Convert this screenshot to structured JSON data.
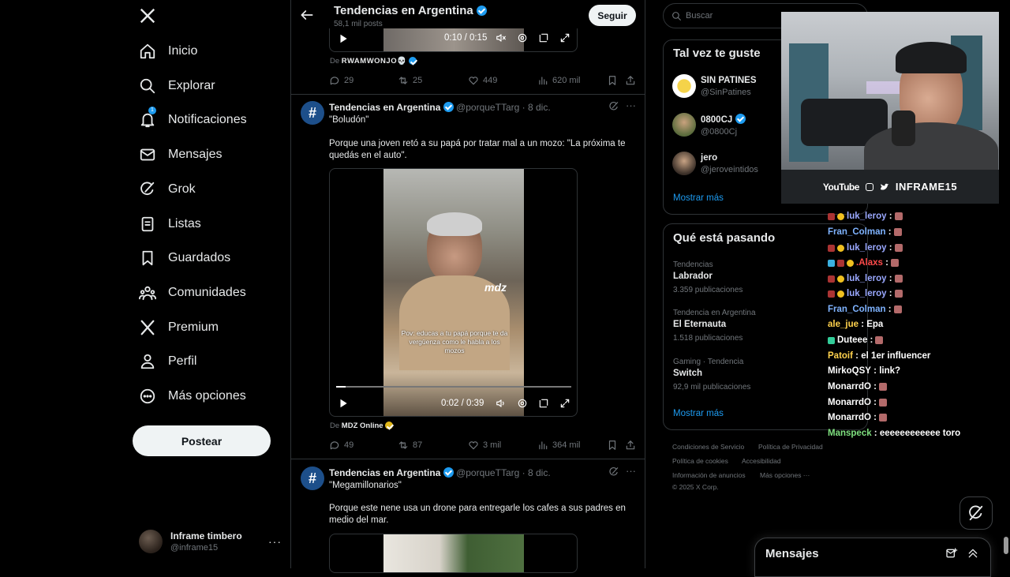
{
  "nav": {
    "logo": "X",
    "items": [
      {
        "label": "Inicio",
        "icon": "home-icon"
      },
      {
        "label": "Explorar",
        "icon": "search-icon"
      },
      {
        "label": "Notificaciones",
        "icon": "bell-icon",
        "badge": "1"
      },
      {
        "label": "Mensajes",
        "icon": "mail-icon"
      },
      {
        "label": "Grok",
        "icon": "grok-icon"
      },
      {
        "label": "Listas",
        "icon": "list-icon"
      },
      {
        "label": "Guardados",
        "icon": "bookmark-icon"
      },
      {
        "label": "Comunidades",
        "icon": "communities-icon"
      },
      {
        "label": "Premium",
        "icon": "x-logo-icon"
      },
      {
        "label": "Perfil",
        "icon": "user-icon"
      },
      {
        "label": "Más opciones",
        "icon": "more-circle-icon"
      }
    ],
    "post_button": "Postear",
    "account": {
      "name": "Inframe timbero",
      "handle": "@inframe15"
    }
  },
  "feed": {
    "header": {
      "title": "Tendencias en Argentina",
      "subtitle": "58,1 mil posts",
      "follow_label": "Seguir"
    },
    "top_tweet": {
      "video_time": "0:10 / 0:15",
      "source_prefix": "De",
      "source": "RWAMWONJO💀",
      "actions": {
        "replies": "29",
        "retweets": "25",
        "likes": "449",
        "views": "620 mil"
      }
    },
    "tweets": [
      {
        "author": "Tendencias en Argentina",
        "handle": "@porqueTTarg",
        "date": "· 8 dic.",
        "title": "\"Boludón\"",
        "text": "Porque una joven retó a su papá por tratar mal a un mozo: \"La próxima te quedás en el auto\".",
        "caption": "Pov: educas a tu papá porque te da vergüenza como le habla a los mozos",
        "watermark": "mdz",
        "video_time": "0:02 / 0:39",
        "source_prefix": "De",
        "source": "MDZ Online",
        "actions": {
          "replies": "49",
          "retweets": "87",
          "likes": "3 mil",
          "views": "364 mil"
        }
      },
      {
        "author": "Tendencias en Argentina",
        "handle": "@porqueTTarg",
        "date": "· 8 dic.",
        "title": "\"Megamillonarios\"",
        "text": "Porque este nene usa un drone para entregarle los cafes a sus padres en medio del mar."
      }
    ]
  },
  "right": {
    "search_placeholder": "Buscar",
    "suggest": {
      "title": "Tal vez te guste",
      "users": [
        {
          "name": "SIN PATINES",
          "handle": "@SinPatines"
        },
        {
          "name": "0800CJ",
          "handle": "@0800Cj"
        },
        {
          "name": "jero",
          "handle": "@jeroveintidos"
        }
      ],
      "more": "Mostrar más"
    },
    "trends": {
      "title": "Qué está pasando",
      "items": [
        {
          "category": "Tendencias",
          "name": "Labrador",
          "count": "3.359 publicaciones"
        },
        {
          "category": "Tendencia en Argentina",
          "name": "El Eternauta",
          "count": "1.518 publicaciones"
        },
        {
          "category": "Gaming · Tendencia",
          "name": "Switch",
          "count": "92,9 mil publicaciones"
        }
      ],
      "more": "Mostrar más"
    },
    "footer": {
      "links": [
        "Condiciones de Servicio",
        "Política de Privacidad",
        "Política de cookies",
        "Accesibilidad",
        "Información de anuncios",
        "Más opciones ···"
      ],
      "copyright": "© 2025 X Corp."
    }
  },
  "overlay": {
    "webcam_bar": {
      "youtube": "YouTube",
      "channel": "INFRAME15"
    },
    "chat": [
      {
        "user": "luk_leroy",
        "msg": "",
        "color": "#9aa8ff"
      },
      {
        "user": "Fran_Colman",
        "msg": "",
        "color": "#7fb3ff"
      },
      {
        "user": "luk_leroy",
        "msg": "",
        "color": "#9aa8ff"
      },
      {
        "user": ".Alaxs",
        "msg": "",
        "color": "#ff4b4b"
      },
      {
        "user": "luk_leroy",
        "msg": "",
        "color": "#9aa8ff"
      },
      {
        "user": "luk_leroy",
        "msg": "",
        "color": "#9aa8ff"
      },
      {
        "user": "Fran_Colman",
        "msg": "",
        "color": "#7fb3ff"
      },
      {
        "user": "ale_jue",
        "msg": "Epa",
        "color": "#ffd24d"
      },
      {
        "user": "Duteee",
        "msg": "",
        "color": "#ffffff"
      },
      {
        "user": "Patoif",
        "msg": "el 1er influencer",
        "color": "#ffd24d"
      },
      {
        "user": "MirkoQSY",
        "msg": "link?",
        "color": "#ffffff"
      },
      {
        "user": "MonarrdO",
        "msg": "",
        "color": "#ffffff"
      },
      {
        "user": "MonarrdO",
        "msg": "",
        "color": "#ffffff"
      },
      {
        "user": "MonarrdO",
        "msg": "",
        "color": "#ffffff"
      },
      {
        "user": "Manspeck",
        "msg": "eeeeeeeeeeee toro",
        "color": "#7fe07f"
      }
    ],
    "messages_drawer": "Mensajes"
  }
}
